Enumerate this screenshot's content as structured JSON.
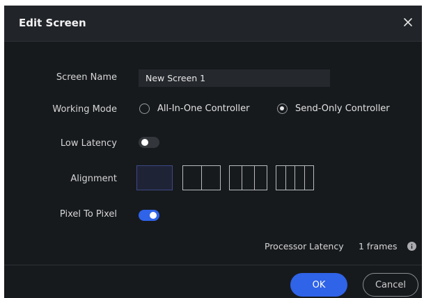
{
  "dialog": {
    "title": "Edit Screen"
  },
  "screen_name": {
    "label": "Screen Name",
    "value": "New Screen 1"
  },
  "working_mode": {
    "label": "Working Mode",
    "options": [
      {
        "label": "All-In-One Controller",
        "selected": false
      },
      {
        "label": "Send-Only Controller",
        "selected": true
      }
    ]
  },
  "low_latency": {
    "label": "Low Latency",
    "enabled": false
  },
  "alignment": {
    "label": "Alignment",
    "options": [
      {
        "segments": 1,
        "selected": true
      },
      {
        "segments": 2,
        "selected": false
      },
      {
        "segments": 3,
        "selected": false
      },
      {
        "segments": 4,
        "selected": false
      }
    ]
  },
  "pixel_to_pixel": {
    "label": "Pixel To Pixel",
    "enabled": true
  },
  "processor_latency": {
    "label": "Processor Latency",
    "value": "1 frames"
  },
  "buttons": {
    "ok": "OK",
    "cancel": "Cancel"
  },
  "colors": {
    "accent": "#2f63e8",
    "background": "#171a1d",
    "header": "#212429"
  },
  "icons": {
    "close": "close-icon",
    "info": "info-icon"
  }
}
